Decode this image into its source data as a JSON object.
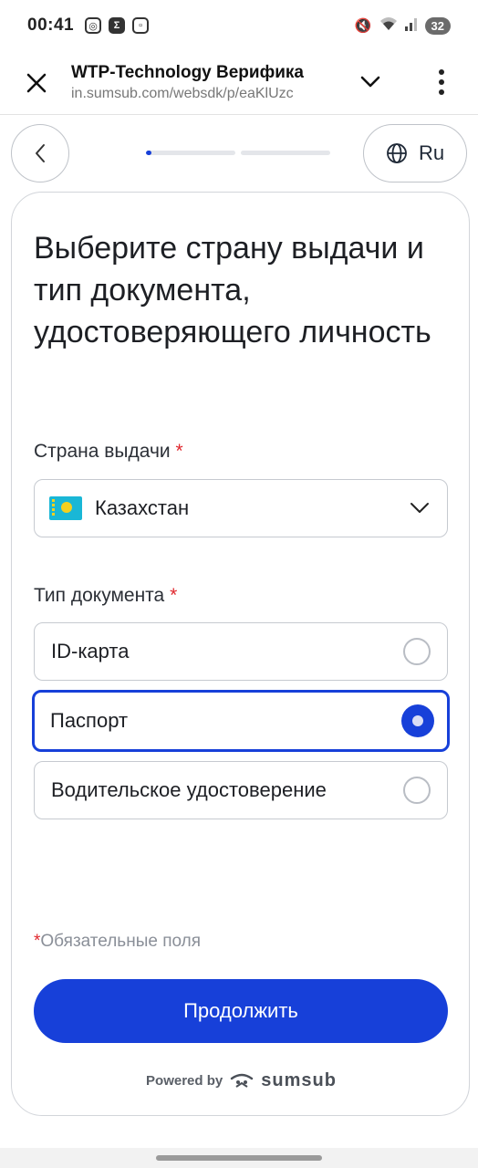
{
  "status_bar": {
    "time": "00:41",
    "battery": "32",
    "left_icons": [
      "instagram-icon",
      "sigma-app-icon",
      "screenshot-icon"
    ],
    "right_icons": [
      "mute-icon",
      "wifi-icon",
      "signal-icon"
    ]
  },
  "browser": {
    "title": "WTP-Technology Верифика",
    "url": "in.sumsub.com/websdk/p/eaKlUzc"
  },
  "nav": {
    "progress": [
      0.06,
      0
    ],
    "language": "Ru"
  },
  "form": {
    "heading": "Выберите страну выдачи и тип документа, удостоверяющего личность",
    "country_label": "Страна выдачи",
    "country_value": "Казахстан",
    "required_mark": "*",
    "doctype_label": "Тип документа",
    "options": [
      {
        "label": "ID-карта",
        "selected": false
      },
      {
        "label": "Паспорт",
        "selected": true
      },
      {
        "label": "Водительское удостоверение",
        "selected": false
      }
    ],
    "required_note": "Обязательные поля",
    "continue_label": "Продолжить"
  },
  "footer": {
    "powered_by": "Powered by",
    "brand": "sumsub"
  },
  "colors": {
    "accent": "#1740d9",
    "required": "#e0282e"
  }
}
